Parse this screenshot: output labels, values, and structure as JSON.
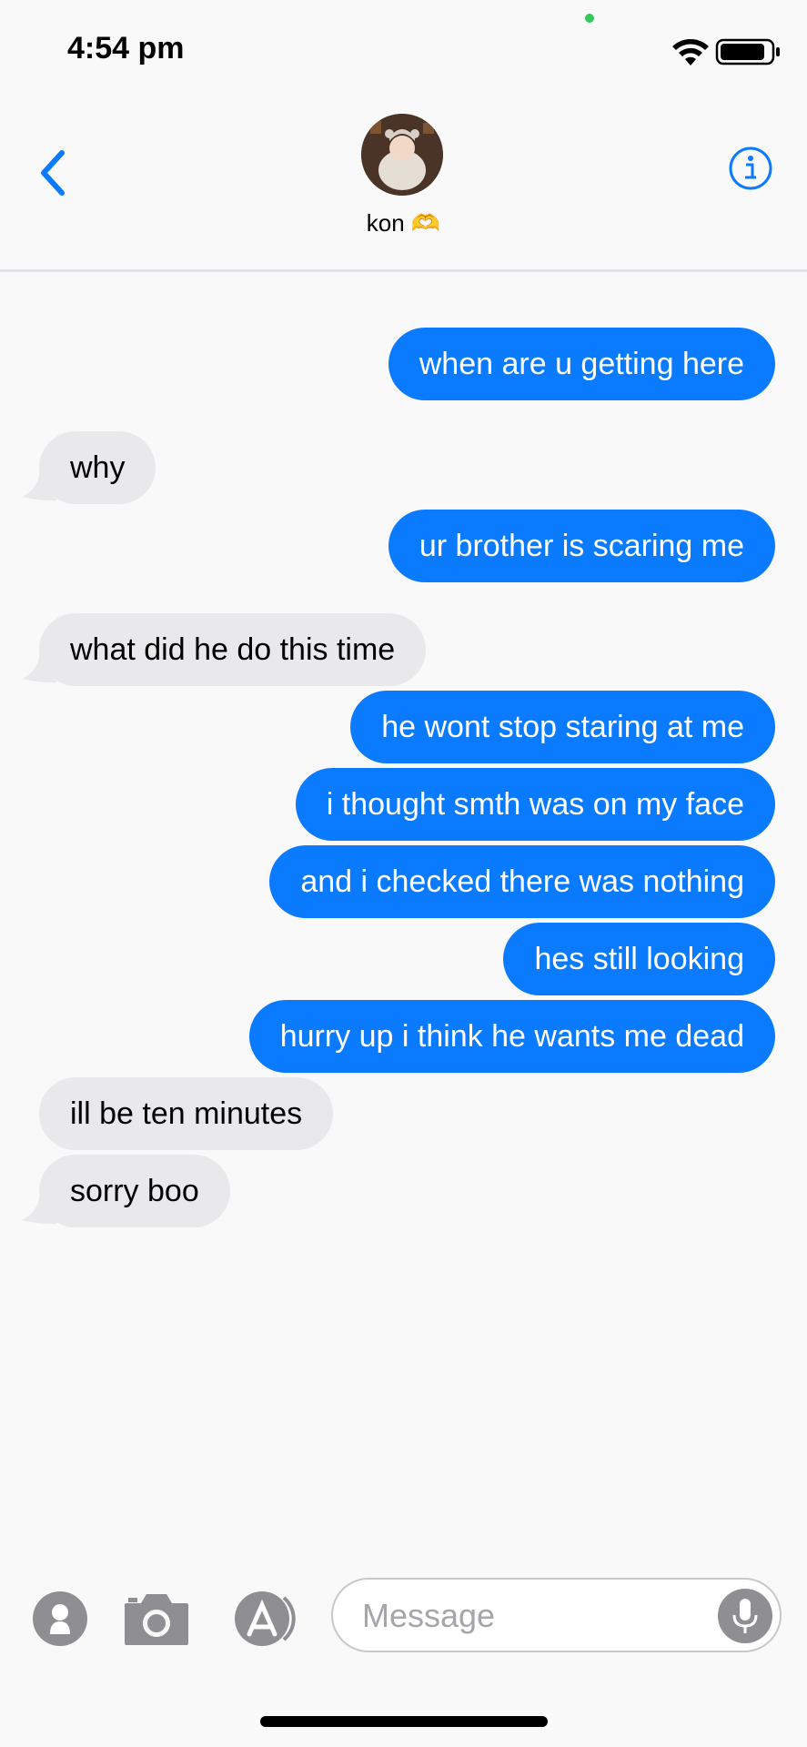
{
  "status_bar": {
    "time": "4:54 pm"
  },
  "header": {
    "contact_name": "kon 🫶"
  },
  "messages": [
    {
      "type": "sent",
      "text": "when are u getting here"
    },
    {
      "type": "received",
      "text": "why"
    },
    {
      "type": "sent",
      "text": "ur brother is scaring me"
    },
    {
      "type": "received",
      "text": "what did he do this time"
    },
    {
      "type": "sent",
      "text": "he wont stop staring at me"
    },
    {
      "type": "sent",
      "text": "i thought smth was on my face"
    },
    {
      "type": "sent",
      "text": "and i checked there was nothing"
    },
    {
      "type": "sent",
      "text": "hes still looking"
    },
    {
      "type": "sent",
      "text": "hurry up i think he wants me dead"
    },
    {
      "type": "received",
      "text": "ill be ten minutes"
    },
    {
      "type": "received",
      "text": "sorry boo"
    }
  ],
  "input_bar": {
    "placeholder": "Message"
  },
  "colors": {
    "sent_bubble": "#0a7aff",
    "received_bubble": "#e9e9eb",
    "accent": "#0a7aff"
  }
}
